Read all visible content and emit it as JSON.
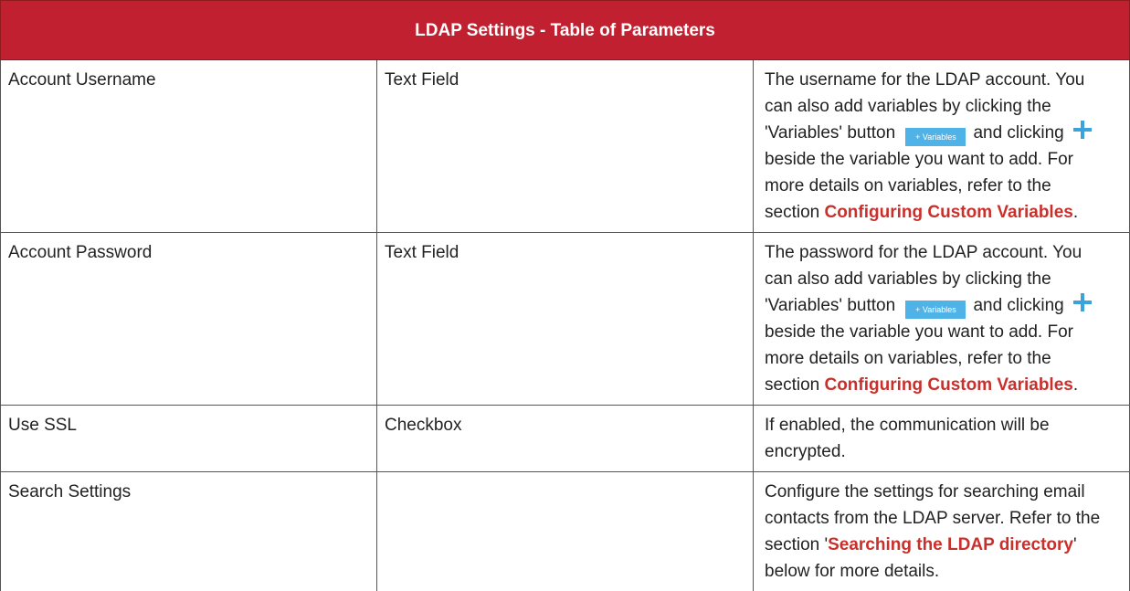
{
  "colors": {
    "header_bg": "#c0202f",
    "link": "#c9302c",
    "variables_button_bg": "#4fb3e8",
    "plus_icon": "#3aa3dc"
  },
  "table": {
    "title": "LDAP Settings - Table of Parameters",
    "rows": [
      {
        "name": "Account Username",
        "type": "Text Field",
        "desc_part1": "The username for the LDAP account. You can also add variables by clicking the 'Variables' button",
        "button_label": "+ Variables",
        "desc_part2": "and clicking",
        "desc_part3": "beside the variable you want to add. For more details on variables, refer to the section",
        "link": "Configuring Custom Variables",
        "desc_end": "."
      },
      {
        "name": "Account Password",
        "type": "Text Field",
        "desc_part1": "The password for the LDAP account. You can also add variables by clicking the 'Variables' button",
        "button_label": "+ Variables",
        "desc_part2": "and clicking",
        "desc_part3": "beside the variable you want to add. For more details on variables, refer to the section",
        "link": "Configuring Custom Variables",
        "desc_end": "."
      },
      {
        "name": "Use SSL",
        "type": "Checkbox",
        "desc": "If enabled, the communication will be encrypted."
      },
      {
        "name": "Search Settings",
        "type": "",
        "desc_part1": "Configure the settings for searching email contacts from the LDAP server. Refer to the section '",
        "link": "Searching the LDAP directory",
        "desc_part2": "' below for more details."
      }
    ]
  }
}
